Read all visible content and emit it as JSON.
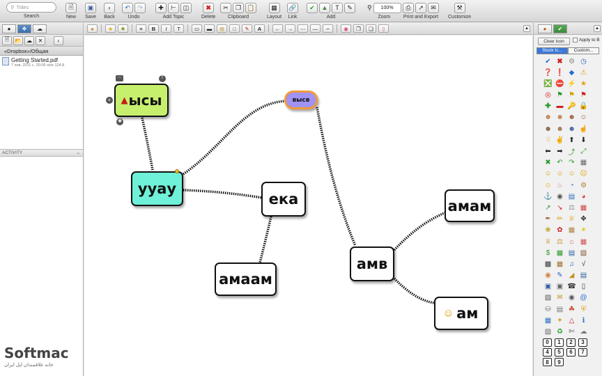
{
  "toolbar": {
    "search_placeholder": "Titles",
    "search_label": "Search",
    "new_label": "New",
    "save_label": "Save",
    "back_label": "Back",
    "undo_label": "Undo",
    "add_topic_label": "Add Topic",
    "delete_label": "Delete",
    "clipboard_label": "Clipboard",
    "layout_label": "Layout",
    "link_label": "Link",
    "add_label": "Add",
    "zoom_label": "Zoom",
    "zoom_value": "100%",
    "print_export_label": "Print and Export",
    "customize_label": "Customize"
  },
  "left_panel": {
    "path": "«Dropbox»/Общая",
    "files": [
      {
        "name": "Getting Started.pdf",
        "meta": "7 янв. 2011 г., 20:05 size 124.8"
      }
    ],
    "activity_label": "ACTIVITY"
  },
  "logo": {
    "name": "Softmac",
    "tagline": "خانه علاقمندان اپل ایران"
  },
  "canvas": {
    "topics": [
      {
        "id": "t1",
        "text": "ысы",
        "fill": "#c6ef6e"
      },
      {
        "id": "t2",
        "text": "ууау",
        "fill": "#6ef1d8"
      },
      {
        "id": "t3",
        "text": "высв",
        "fill": "#9f93f4"
      },
      {
        "id": "t4",
        "text": "ека",
        "fill": "#ffffff"
      },
      {
        "id": "t5",
        "text": "амаам",
        "fill": "#ffffff"
      },
      {
        "id": "t6",
        "text": "амв",
        "fill": "#ffffff"
      },
      {
        "id": "t7",
        "text": "амам",
        "fill": "#ffffff"
      },
      {
        "id": "t8",
        "text": "ам",
        "fill": "#ffffff"
      }
    ]
  },
  "right_panel": {
    "clear_icon_label": "Clear Icon",
    "apply_label": "Apply to B",
    "tab_stock": "Stock Ic...",
    "tab_custom": "Custom...",
    "numbers": [
      "0",
      "1",
      "2",
      "3",
      "4",
      "5",
      "6",
      "7",
      "8",
      "9"
    ]
  }
}
